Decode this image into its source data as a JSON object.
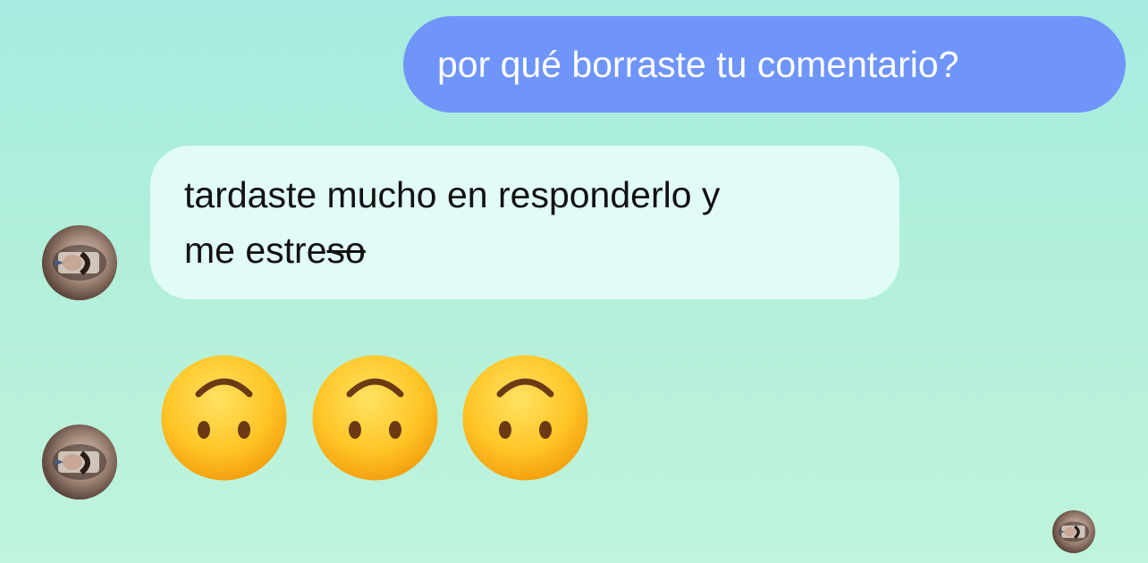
{
  "conversation": {
    "outgoing_message": "por qué borraste tu comentario?",
    "incoming_message": {
      "line1": "tardaste mucho en responderlo y",
      "line2_prefix": "me estre",
      "line2_struck": "so"
    },
    "reaction_emoji": "upside-down-face",
    "reaction_count": 3
  },
  "colors": {
    "background_top": "#a6ece0",
    "background_bottom": "#c0f4dc",
    "outgoing_bubble": "#6f95fb",
    "incoming_bubble": "#e1fbf7",
    "emoji_face": "#ffc526"
  }
}
